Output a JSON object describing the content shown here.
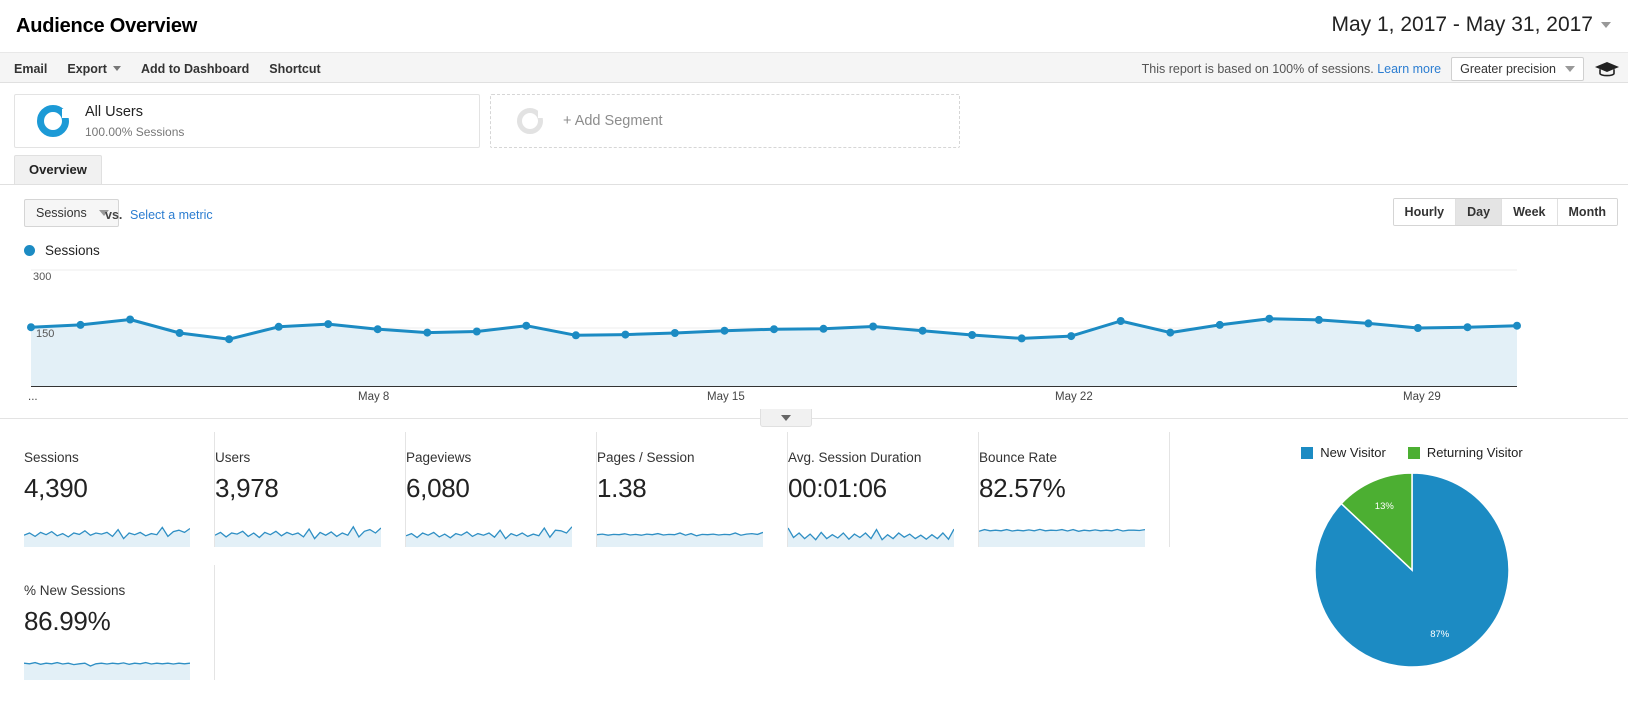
{
  "header": {
    "title": "Audience Overview",
    "date_range": "May 1, 2017 - May 31, 2017",
    "date_range_caret": "chevron-down-icon"
  },
  "toolbar": {
    "email": "Email",
    "export": "Export",
    "add_to_dashboard": "Add to Dashboard",
    "shortcut": "Shortcut",
    "sampling_note": "This report is based on 100% of sessions.",
    "learn_more": "Learn more",
    "precision": "Greater precision"
  },
  "segments": {
    "all_users_name": "All Users",
    "all_users_sub": "100.00% Sessions",
    "add_segment": "+ Add Segment"
  },
  "tabs": [
    {
      "label": "Overview",
      "active": true
    }
  ],
  "chart_controls": {
    "metric": "Sessions",
    "vs": "vs.",
    "select_metric": "Select a metric",
    "granularity": [
      {
        "label": "Hourly",
        "active": false
      },
      {
        "label": "Day",
        "active": true
      },
      {
        "label": "Week",
        "active": false
      },
      {
        "label": "Month",
        "active": false
      }
    ]
  },
  "chart_data": {
    "type": "line",
    "title": "Sessions",
    "series_name": "Sessions",
    "xlabel": "",
    "ylabel": "Sessions",
    "ylim": [
      0,
      300
    ],
    "ytick_labels": [
      "300",
      "150"
    ],
    "ytick_values": [
      300,
      150
    ],
    "grid": true,
    "legend": "Sessions",
    "line_color": "#1c8bc3",
    "fill_color": "#e3f0f7",
    "x": [
      "May 1",
      "May 2",
      "May 3",
      "May 4",
      "May 5",
      "May 6",
      "May 7",
      "May 8",
      "May 9",
      "May 10",
      "May 11",
      "May 12",
      "May 13",
      "May 14",
      "May 15",
      "May 16",
      "May 17",
      "May 18",
      "May 19",
      "May 20",
      "May 21",
      "May 22",
      "May 23",
      "May 24",
      "May 25",
      "May 26",
      "May 27",
      "May 28",
      "May 29",
      "May 30",
      "May 31"
    ],
    "xtick_labels": [
      "...",
      "May 8",
      "May 15",
      "May 22",
      "May 29"
    ],
    "values": [
      152,
      158,
      172,
      137,
      121,
      153,
      160,
      147,
      138,
      141,
      156,
      131,
      133,
      137,
      143,
      147,
      148,
      154,
      143,
      132,
      123,
      129,
      168,
      138,
      158,
      174,
      171,
      162,
      150,
      152,
      156
    ]
  },
  "metric_cards": [
    {
      "label": "Sessions",
      "value": "4,390",
      "spark": [
        0.42,
        0.5,
        0.38,
        0.52,
        0.44,
        0.55,
        0.4,
        0.48,
        0.36,
        0.5,
        0.45,
        0.58,
        0.42,
        0.5,
        0.46,
        0.52,
        0.38,
        0.62,
        0.3,
        0.5,
        0.44,
        0.52,
        0.4,
        0.48,
        0.44,
        0.7,
        0.38,
        0.55,
        0.6,
        0.52,
        0.66
      ]
    },
    {
      "label": "Users",
      "value": "3,978",
      "spark": [
        0.42,
        0.52,
        0.36,
        0.5,
        0.46,
        0.56,
        0.38,
        0.5,
        0.34,
        0.52,
        0.44,
        0.56,
        0.4,
        0.52,
        0.44,
        0.5,
        0.36,
        0.64,
        0.3,
        0.52,
        0.42,
        0.54,
        0.38,
        0.5,
        0.42,
        0.72,
        0.36,
        0.56,
        0.62,
        0.5,
        0.68
      ]
    },
    {
      "label": "Pageviews",
      "value": "6,080",
      "spark": [
        0.4,
        0.48,
        0.34,
        0.5,
        0.42,
        0.52,
        0.36,
        0.46,
        0.33,
        0.48,
        0.42,
        0.54,
        0.38,
        0.48,
        0.42,
        0.5,
        0.35,
        0.6,
        0.3,
        0.48,
        0.4,
        0.5,
        0.38,
        0.46,
        0.4,
        0.68,
        0.35,
        0.6,
        0.58,
        0.5,
        0.72
      ]
    },
    {
      "label": "Pages / Session",
      "value": "1.38",
      "spark": [
        0.44,
        0.46,
        0.42,
        0.45,
        0.44,
        0.47,
        0.43,
        0.45,
        0.42,
        0.46,
        0.44,
        0.48,
        0.43,
        0.45,
        0.44,
        0.5,
        0.42,
        0.48,
        0.4,
        0.45,
        0.44,
        0.46,
        0.43,
        0.45,
        0.44,
        0.5,
        0.42,
        0.46,
        0.48,
        0.45,
        0.52
      ]
    },
    {
      "label": "Avg. Session Duration",
      "value": "00:01:06",
      "spark": [
        0.68,
        0.34,
        0.5,
        0.3,
        0.46,
        0.26,
        0.52,
        0.3,
        0.44,
        0.32,
        0.5,
        0.28,
        0.46,
        0.34,
        0.5,
        0.3,
        0.62,
        0.26,
        0.44,
        0.3,
        0.5,
        0.35,
        0.46,
        0.3,
        0.42,
        0.28,
        0.44,
        0.3,
        0.5,
        0.28,
        0.64
      ]
    },
    {
      "label": "Bounce Rate",
      "value": "82.57%",
      "spark": [
        0.56,
        0.62,
        0.58,
        0.6,
        0.58,
        0.62,
        0.57,
        0.6,
        0.58,
        0.61,
        0.58,
        0.63,
        0.58,
        0.6,
        0.59,
        0.62,
        0.57,
        0.62,
        0.56,
        0.6,
        0.58,
        0.61,
        0.58,
        0.6,
        0.58,
        0.63,
        0.57,
        0.6,
        0.6,
        0.59,
        0.62
      ]
    },
    {
      "label": "% New Sessions",
      "value": "86.99%",
      "spark": [
        0.6,
        0.58,
        0.62,
        0.56,
        0.6,
        0.58,
        0.62,
        0.57,
        0.6,
        0.55,
        0.58,
        0.6,
        0.5,
        0.58,
        0.6,
        0.57,
        0.6,
        0.58,
        0.61,
        0.56,
        0.6,
        0.58,
        0.62,
        0.57,
        0.6,
        0.58,
        0.6,
        0.57,
        0.6,
        0.58,
        0.6
      ]
    }
  ],
  "pie_chart": {
    "type": "pie",
    "title": "",
    "labels": [
      "New Visitor",
      "Returning Visitor"
    ],
    "values": [
      87,
      13
    ],
    "data_labels": [
      "87%",
      "13%"
    ],
    "colors": [
      "#1c8bc3",
      "#4caf32"
    ],
    "legend_position": "top"
  }
}
